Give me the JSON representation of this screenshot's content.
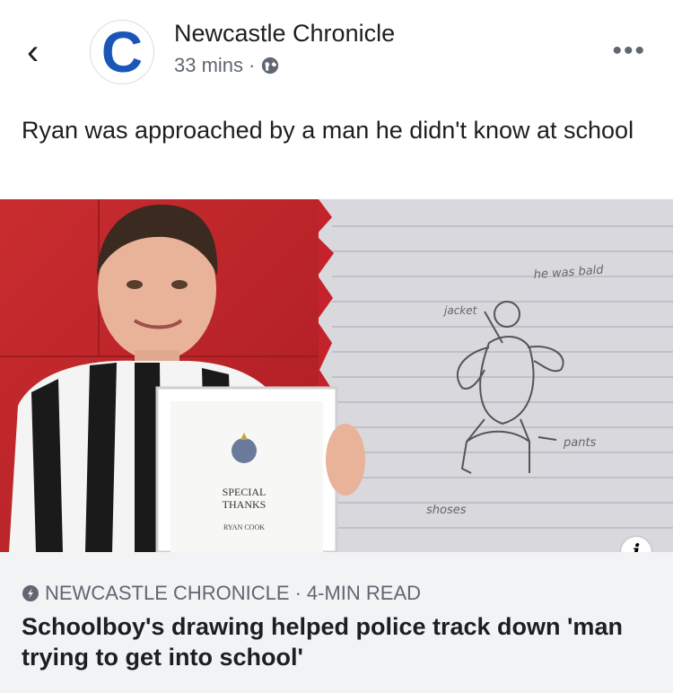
{
  "post": {
    "page_name": "Newcastle Chronicle",
    "logo_letter": "C",
    "time": "33 mins",
    "separator": "·",
    "caption": "Ryan was approached by a man he didn't know at school"
  },
  "image": {
    "certificate_title": "SPECIAL THANKS",
    "certificate_name": "RYAN COOK",
    "drawing_labels": {
      "top": "he was bald",
      "jacket": "jacket",
      "pants": "pants",
      "shoes": "shoses"
    }
  },
  "link": {
    "source": "NEWCASTLE CHRONICLE",
    "read_time": "4-MIN READ",
    "separator": "·",
    "headline": "Schoolboy's drawing helped police track down 'man trying to get into school'"
  },
  "icons": {
    "back": "back-chevron-icon",
    "globe": "globe-icon",
    "more": "more-icon",
    "info": "info-icon",
    "source": "external-link-icon"
  },
  "colors": {
    "brand": "#1a56b8",
    "background_red": "#c4232b",
    "link_box": "#f2f3f5"
  }
}
